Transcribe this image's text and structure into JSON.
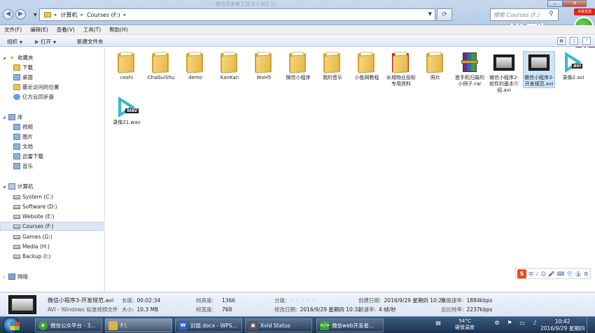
{
  "window": {
    "faint_title": "微信开发者工具 5.7.0(2.1)"
  },
  "address": {
    "crumbs": [
      "计算机",
      "Courses (F:)"
    ]
  },
  "search": {
    "placeholder": "搜索 Courses (F:)"
  },
  "watermark": "优酷",
  "promo": {
    "badge": "点我发送",
    "count": "86"
  },
  "menu": [
    "文件(F)",
    "编辑(E)",
    "查看(V)",
    "工具(T)",
    "帮助(H)"
  ],
  "toolbar": {
    "organize": "组织",
    "open": "打开",
    "new_folder": "新建文件夹"
  },
  "nav": {
    "favorites": "收藏夹",
    "favorites_items": [
      "下载",
      "桌面",
      "最近访问的位置",
      "亿方云同步盘"
    ],
    "libraries": "库",
    "libraries_items": [
      "视频",
      "图片",
      "文档",
      "迅雷下载",
      "音乐"
    ],
    "computer": "计算机",
    "drives": [
      "System (C:)",
      "Software (D:)",
      "Website (E:)",
      "Courses (F:)",
      "Games (G:)",
      "Media (H:)",
      "Backup (I:)"
    ],
    "selected_drive": "Courses (F:)",
    "network": "网络"
  },
  "files": [
    {
      "label": "ceshi",
      "type": "folder"
    },
    {
      "label": "ChaGuiShu",
      "type": "folder"
    },
    {
      "label": "demo",
      "type": "folder"
    },
    {
      "label": "KanKan",
      "type": "folder"
    },
    {
      "label": "WxH5",
      "type": "folder"
    },
    {
      "label": "微信小程序",
      "type": "folder"
    },
    {
      "label": "我的音乐",
      "type": "folder"
    },
    {
      "label": "小鱼网教程",
      "type": "folder"
    },
    {
      "label": "长城物业投标专用资料",
      "type": "folder-dark"
    },
    {
      "label": "照片",
      "type": "folder"
    },
    {
      "label": "查手机归属的小例子.rar",
      "type": "rar"
    },
    {
      "label": "微信小程序2-软件的基本介绍.avi",
      "type": "video"
    },
    {
      "label": "微信小程序3-开发规范.avi",
      "type": "video",
      "selected": true
    },
    {
      "label": "录像2.avi",
      "type": "media",
      "tag": "AVI"
    },
    {
      "label": "录像21.wav",
      "type": "media",
      "tag": "WAV"
    }
  ],
  "ime": {
    "brand": "S",
    "glyphs": [
      "中",
      "ﾉ",
      "☺",
      "🎤",
      "⌨",
      "👕",
      "👔",
      "⚙"
    ]
  },
  "details": {
    "name": "微信小程序3-开发规范.avi",
    "type": "AVI - Windows 标准视频文件",
    "length_label": "长度:",
    "length": "00:02:34",
    "size_label": "大小:",
    "size": "10.3 MB",
    "frame_height_label": "帧高度:",
    "frame_height": "1366",
    "frame_width_label": "帧宽度:",
    "frame_width": "768",
    "rating_label": "分级:",
    "modified_label": "修改日期:",
    "modified": "2016/9/29 星期四 10:32",
    "created_label": "创建日期:",
    "created": "2016/9/29 星期四 10:29",
    "frame_rate_label": "帧速率:",
    "frame_rate": "4 帧/秒",
    "data_rate_label": "数据速率:",
    "data_rate": "1884kbps",
    "total_bitrate_label": "总比特率:",
    "total_bitrate": "2237kbps"
  },
  "taskbar": {
    "tasks": [
      {
        "label": "微信公众平台 - 3...",
        "icon": "chrome-icon",
        "color": "#3aa13a"
      },
      {
        "label": "F:\\",
        "icon": "explorer-icon",
        "color": "#d8b24c",
        "active": true
      },
      {
        "label": "封面.docx - WPS...",
        "icon": "wps-icon",
        "color": "#2b62c4"
      },
      {
        "label": "Xvid Status",
        "icon": "xvid-icon",
        "color": "#555555"
      },
      {
        "label": "微信web开发者...",
        "icon": "wechat-dev-icon",
        "color": "#3aa13a"
      }
    ],
    "temp": "54°C",
    "temp_label": "硬盘温度",
    "time": "10:42",
    "date": "2016/9/29 星期四"
  }
}
